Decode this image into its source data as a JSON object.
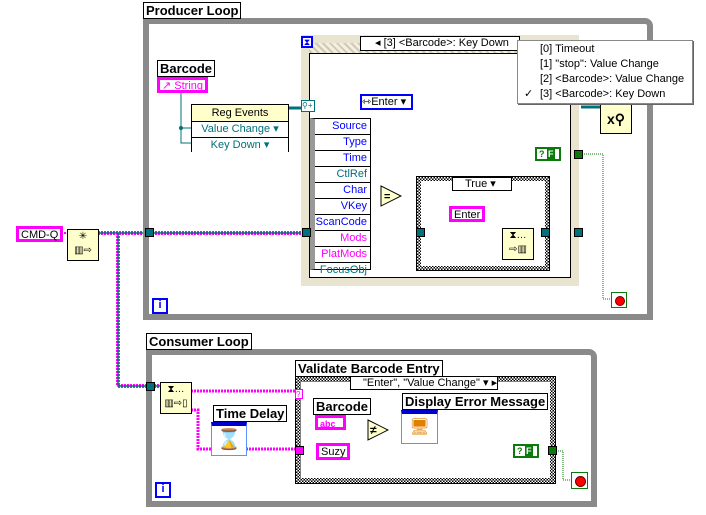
{
  "producer": {
    "label": "Producer Loop",
    "event_selector": "[3] <Barcode>: Key Down",
    "event_menu": [
      {
        "label": "[0] Timeout",
        "checked": false
      },
      {
        "label": "[1] \"stop\": Value Change",
        "checked": false
      },
      {
        "label": "[2] <Barcode>: Value Change",
        "checked": false
      },
      {
        "label": "[3] <Barcode>: Key Down",
        "checked": true
      }
    ],
    "checkmark": "✓",
    "barcode_label": "Barcode",
    "barcode_ref": "String",
    "reg_events": {
      "title": "Reg Events",
      "rows": [
        "Value Change",
        "Key Down"
      ]
    },
    "event_data": [
      "Source",
      "Type",
      "Time",
      "CtlRef",
      "Char",
      "VKey",
      "ScanCode",
      "Mods",
      "PlatMods",
      "FocusObj"
    ],
    "enum_const": "Enter",
    "compare": "=",
    "case_selector": "True",
    "enter_const": "Enter",
    "bool_const": "F",
    "iteration": "i"
  },
  "queue": {
    "name_const": "CMD-Q"
  },
  "consumer": {
    "label": "Consumer Loop",
    "time_delay_label": "Time Delay",
    "case_label": "Validate Barcode Entry",
    "case_selector": "\"Enter\", \"Value Change\"",
    "barcode_label": "Barcode",
    "barcode_term": "abc",
    "suzy_const": "Suzy",
    "compare": "≠",
    "error_label": "Display Error Message",
    "bool_const": "F",
    "iteration": "i"
  },
  "colors": {
    "string_wire": "#ff00ff",
    "queue_wire": "#00707a",
    "bool_wire": "#0a7a0a",
    "numeric_blue": "#0000ff",
    "loop_border": "#8a8a8a"
  }
}
